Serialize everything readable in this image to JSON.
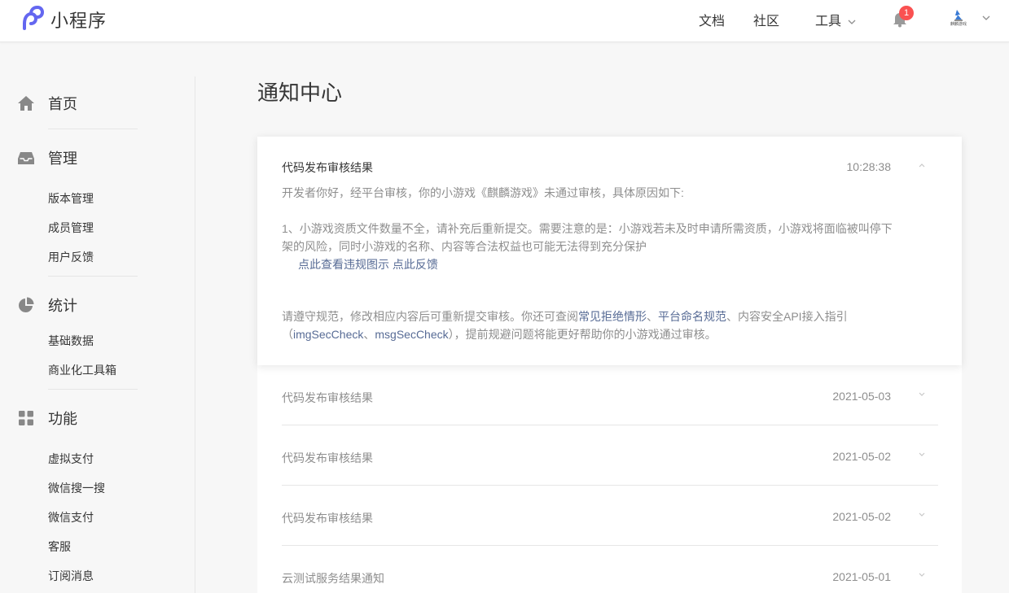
{
  "header": {
    "brand": "小程序",
    "nav": {
      "docs": "文档",
      "community": "社区",
      "tools": "工具"
    },
    "notification_count": "1",
    "avatar_caption": "麒麟游戏"
  },
  "sidebar": {
    "groups": [
      {
        "label": "首页",
        "icon": "home-icon",
        "items": []
      },
      {
        "label": "管理",
        "icon": "inbox-icon",
        "items": [
          "版本管理",
          "成员管理",
          "用户反馈"
        ]
      },
      {
        "label": "统计",
        "icon": "pie-chart-icon",
        "items": [
          "基础数据",
          "商业化工具箱"
        ]
      },
      {
        "label": "功能",
        "icon": "grid-icon",
        "items": [
          "虚拟支付",
          "微信搜一搜",
          "微信支付",
          "客服",
          "订阅消息"
        ]
      }
    ]
  },
  "main": {
    "title": "通知中心",
    "expanded": {
      "title": "代码发布审核结果",
      "time": "10:28:38",
      "intro": "开发者你好，经平台审核，你的小游戏《麒麟游戏》未通过审核，具体原因如下:",
      "reason": "1、小游戏资质文件数量不全，请补充后重新提交。需要注意的是：小游戏若未及时申请所需资质，小游戏将面临被叫停下架的风险，同时小游戏的名称、内容等合法权益也可能无法得到充分保护",
      "link_view": "点此查看违规图示",
      "link_feedback": "点此反馈",
      "footer_prefix": "请遵守规范，修改相应内容后可重新提交审核。你还可查阅",
      "footer_link1": "常见拒绝情形",
      "footer_sep1": "、",
      "footer_link2": "平台命名规范",
      "footer_mid": "、内容安全API接入指引（",
      "footer_link3": "imgSecCheck",
      "footer_sep2": "、",
      "footer_link4": "msgSecCheck",
      "footer_suffix": "），提前规避问题将能更好帮助你的小游戏通过审核。"
    },
    "rows": [
      {
        "title": "代码发布审核结果",
        "date": "2021-05-03"
      },
      {
        "title": "代码发布审核结果",
        "date": "2021-05-02"
      },
      {
        "title": "代码发布审核结果",
        "date": "2021-05-02"
      },
      {
        "title": "云测试服务结果通知",
        "date": "2021-05-01"
      }
    ]
  },
  "colors": {
    "accent_link": "#576b95",
    "badge": "#fa5151",
    "muted_text": "#8e8e8e"
  }
}
